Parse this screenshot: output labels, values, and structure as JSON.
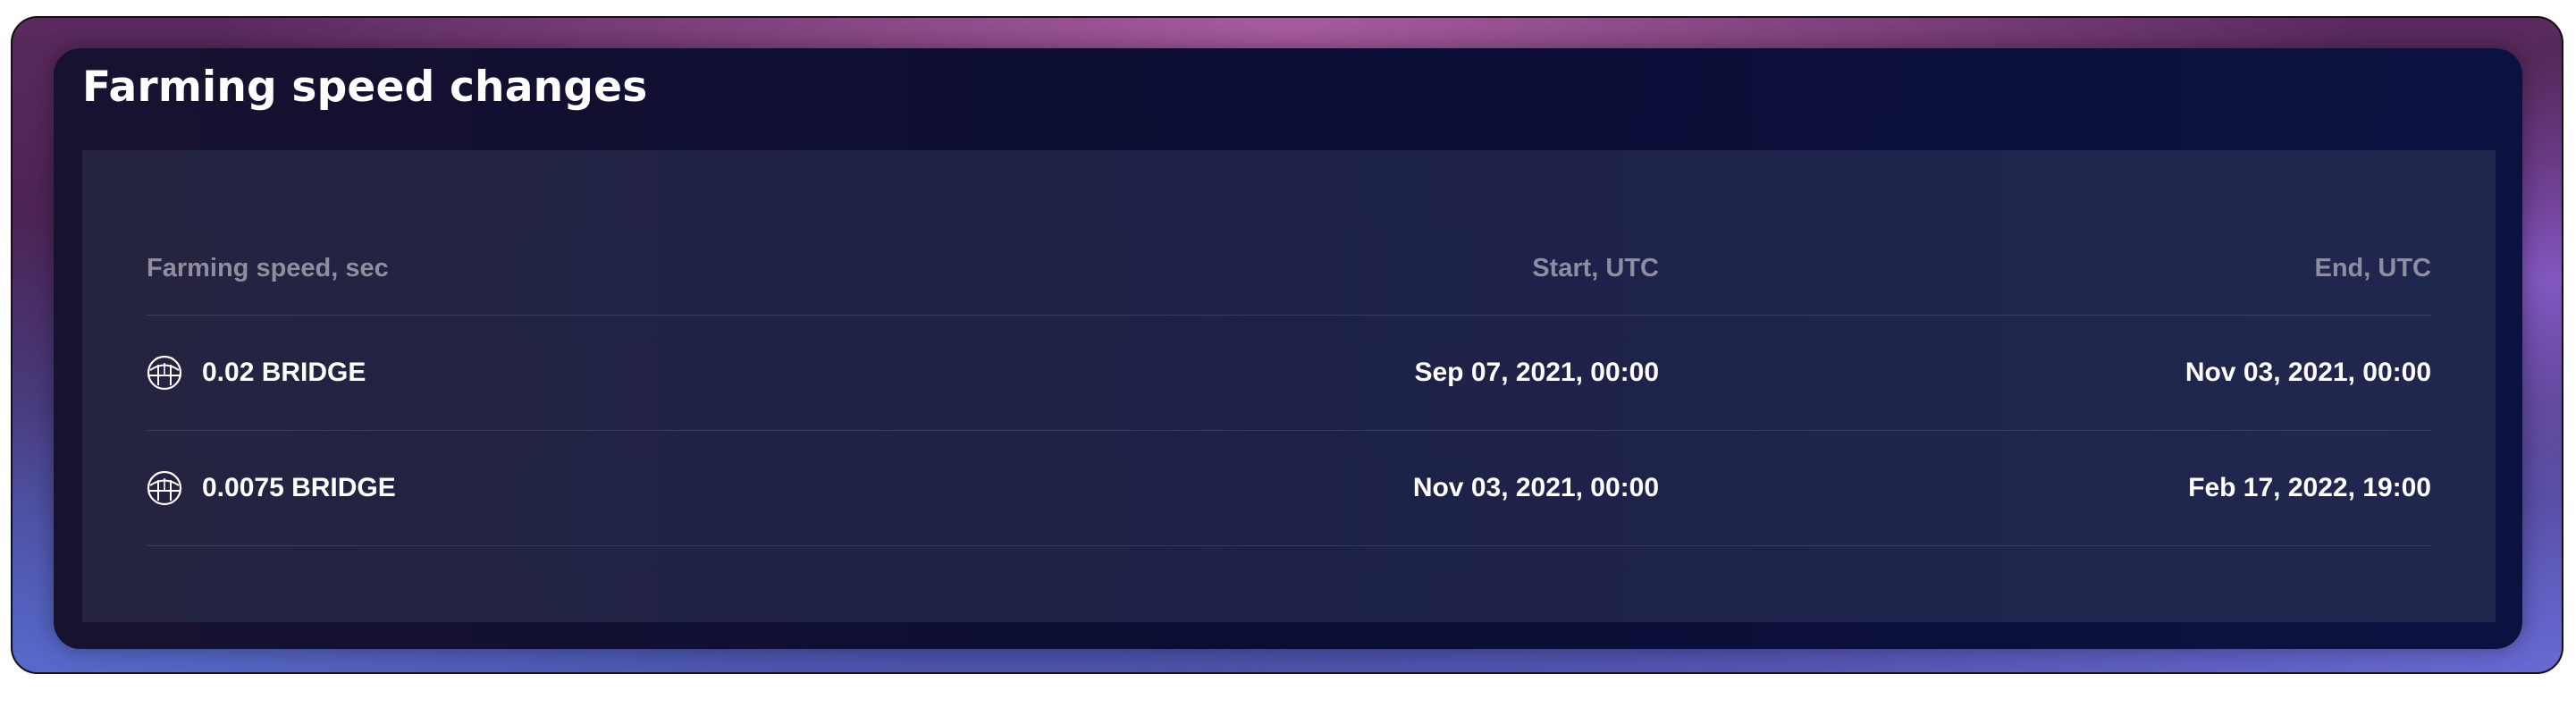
{
  "card": {
    "title": "Farming speed changes"
  },
  "table": {
    "columns": [
      "Farming speed, sec",
      "Start, UTC",
      "End, UTC"
    ],
    "rows": [
      {
        "speed": "0.02 BRIDGE",
        "icon": "bridge-token-icon",
        "start": "Sep 07, 2021, 00:00",
        "end": "Nov 03, 2021, 00:00"
      },
      {
        "speed": "0.0075 BRIDGE",
        "icon": "bridge-token-icon",
        "start": "Nov 03, 2021, 00:00",
        "end": "Feb 17, 2022, 19:00"
      }
    ]
  },
  "colors": {
    "card_bg": "#0a0d34",
    "panel_bg": "#1d2148",
    "header_text": "#8e8ea0",
    "text": "#ffffff"
  }
}
